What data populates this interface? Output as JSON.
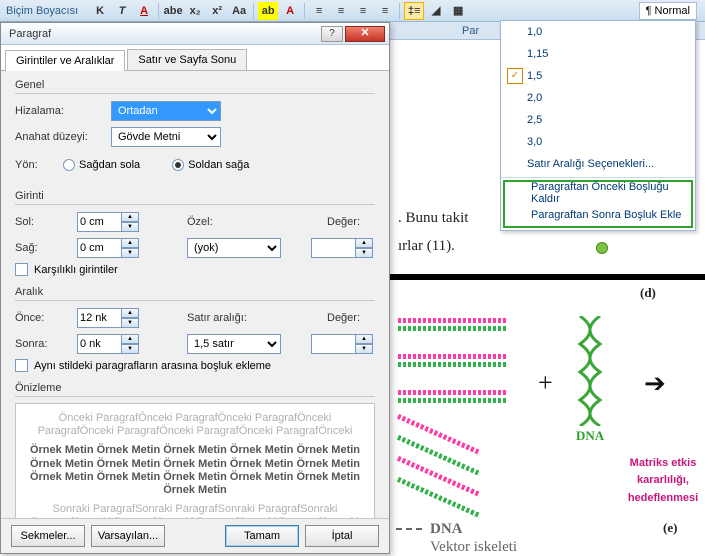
{
  "toolbar": {
    "brush_label": "Biçim Boyacısı",
    "bold": "K",
    "italic": "T",
    "underline": "A",
    "style_normal": "¶ Normal"
  },
  "line_spacing_menu": {
    "items": [
      "1,0",
      "1,15",
      "1,5",
      "2,0",
      "2,5",
      "3,0"
    ],
    "checked_index": 2,
    "options_label": "Satır Aralığı Seçenekleri...",
    "remove_before": "Paragraftan Önceki Boşluğu Kaldır",
    "add_after": "Paragraftan Sonra Boşluk Ekle"
  },
  "dialog": {
    "title": "Paragraf",
    "tabs": {
      "indent": "Girintiler ve Aralıklar",
      "breaks": "Satır ve Sayfa Sonu"
    },
    "general": {
      "legend": "Genel",
      "align_label": "Hizalama:",
      "align_value": "Ortadan",
      "outline_label": "Anahat düzeyi:",
      "outline_value": "Gövde Metni",
      "dir_label": "Yön:",
      "dir_rtl": "Sağdan sola",
      "dir_ltr": "Soldan sağa"
    },
    "indent": {
      "legend": "Girinti",
      "left_label": "Sol:",
      "left_value": "0 cm",
      "right_label": "Sağ:",
      "right_value": "0 cm",
      "special_label": "Özel:",
      "special_value": "(yok)",
      "by_label": "Değer:",
      "by_value": "",
      "mirror_label": "Karşılıklı girintiler"
    },
    "spacing": {
      "legend": "Aralık",
      "before_label": "Önce:",
      "before_value": "12 nk",
      "after_label": "Sonra:",
      "after_value": "0 nk",
      "line_label": "Satır aralığı:",
      "line_value": "1,5 satır",
      "at_label": "Değer:",
      "at_value": "",
      "nospace_label": "Aynı stildeki paragrafların arasına boşluk ekleme"
    },
    "preview_legend": "Önizleme",
    "preview_grey": "Önceki ParagrafÖnceki ParagrafÖnceki ParagrafÖnceki ParagrafÖnceki ParagrafÖnceki ParagrafÖnceki ParagrafÖnceki",
    "preview_dark": "Örnek Metin Örnek Metin Örnek Metin Örnek Metin Örnek Metin Örnek Metin Örnek Metin Örnek Metin Örnek Metin Örnek Metin Örnek Metin Örnek Metin Örnek Metin Örnek Metin Örnek Metin Örnek Metin",
    "preview_grey2": "Sonraki ParagrafSonraki ParagrafSonraki ParagrafSonraki ParagrafSonraki ParagrafSonraki ParagrafSonraki ParagrafSonraki",
    "buttons": {
      "tabs": "Sekmeler...",
      "default": "Varsayılan...",
      "ok": "Tamam",
      "cancel": "İptal"
    }
  },
  "doc": {
    "line1": ". Bunu takit",
    "line2": "ırlar (11).",
    "dna_label": "DNA",
    "letter_d": "(d)",
    "letter_e": "(e)",
    "matrix1": "Matriks etkis",
    "matrix2": "kararlılığı,",
    "matrix3": "hedeflenmesi",
    "dna_dash": "DNA",
    "vector": "Vektor iskeleti"
  }
}
